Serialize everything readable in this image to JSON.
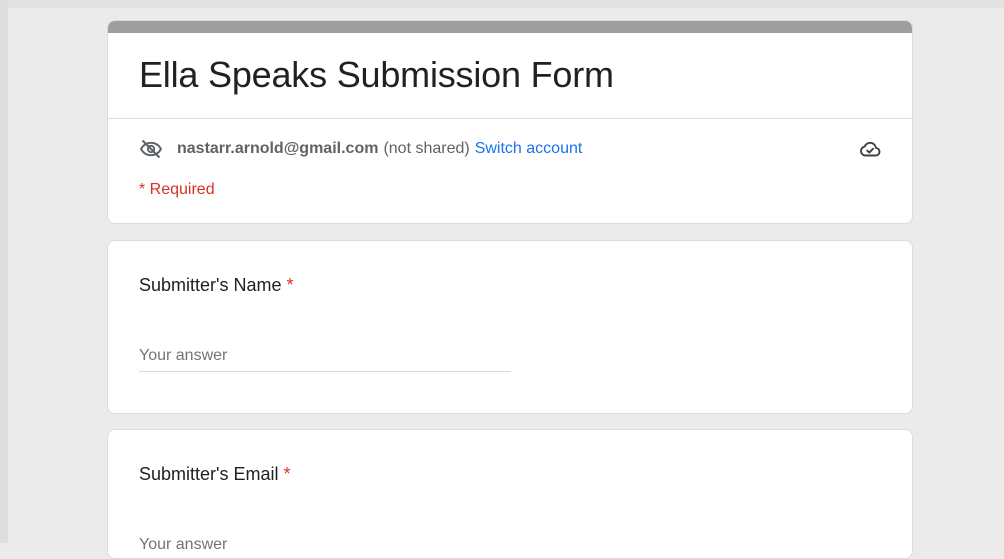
{
  "form": {
    "title": "Ella Speaks Submission Form",
    "account": {
      "email": "nastarr.arnold@gmail.com",
      "shared_note": "(not shared)",
      "switch_label": "Switch account"
    },
    "required_note": "* Required"
  },
  "questions": [
    {
      "label": "Submitter's Name",
      "required_mark": "*",
      "placeholder": "Your answer"
    },
    {
      "label": "Submitter's Email",
      "required_mark": "*",
      "placeholder": "Your answer"
    }
  ],
  "icons": {
    "visibility": "eye-off-icon",
    "save_status": "cloud-check-icon"
  },
  "colors": {
    "accent_bar": "#9e9e9e",
    "link": "#1a73e8",
    "required": "#d93025",
    "background": "#ebebeb"
  }
}
